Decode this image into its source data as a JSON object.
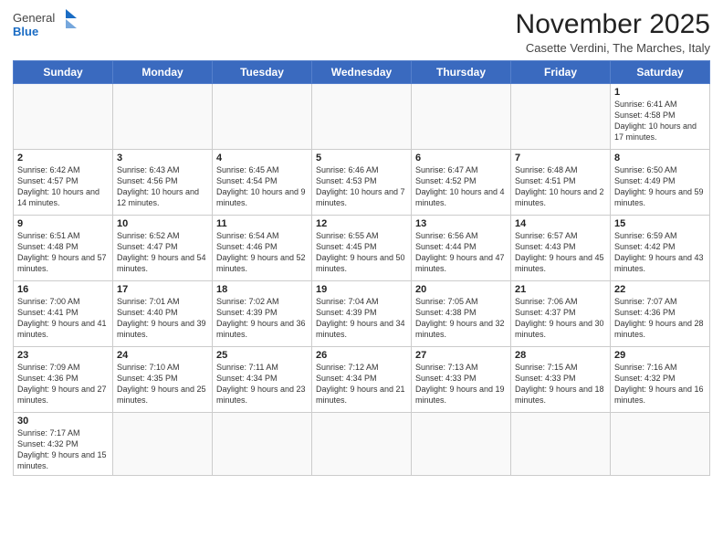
{
  "header": {
    "logo_general": "General",
    "logo_blue": "Blue",
    "month_title": "November 2025",
    "location": "Casette Verdini, The Marches, Italy"
  },
  "weekdays": [
    "Sunday",
    "Monday",
    "Tuesday",
    "Wednesday",
    "Thursday",
    "Friday",
    "Saturday"
  ],
  "weeks": [
    [
      {
        "day": "",
        "info": ""
      },
      {
        "day": "",
        "info": ""
      },
      {
        "day": "",
        "info": ""
      },
      {
        "day": "",
        "info": ""
      },
      {
        "day": "",
        "info": ""
      },
      {
        "day": "",
        "info": ""
      },
      {
        "day": "1",
        "info": "Sunrise: 6:41 AM\nSunset: 4:58 PM\nDaylight: 10 hours\nand 17 minutes."
      }
    ],
    [
      {
        "day": "2",
        "info": "Sunrise: 6:42 AM\nSunset: 4:57 PM\nDaylight: 10 hours\nand 14 minutes."
      },
      {
        "day": "3",
        "info": "Sunrise: 6:43 AM\nSunset: 4:56 PM\nDaylight: 10 hours\nand 12 minutes."
      },
      {
        "day": "4",
        "info": "Sunrise: 6:45 AM\nSunset: 4:54 PM\nDaylight: 10 hours\nand 9 minutes."
      },
      {
        "day": "5",
        "info": "Sunrise: 6:46 AM\nSunset: 4:53 PM\nDaylight: 10 hours\nand 7 minutes."
      },
      {
        "day": "6",
        "info": "Sunrise: 6:47 AM\nSunset: 4:52 PM\nDaylight: 10 hours\nand 4 minutes."
      },
      {
        "day": "7",
        "info": "Sunrise: 6:48 AM\nSunset: 4:51 PM\nDaylight: 10 hours\nand 2 minutes."
      },
      {
        "day": "8",
        "info": "Sunrise: 6:50 AM\nSunset: 4:49 PM\nDaylight: 9 hours\nand 59 minutes."
      }
    ],
    [
      {
        "day": "9",
        "info": "Sunrise: 6:51 AM\nSunset: 4:48 PM\nDaylight: 9 hours\nand 57 minutes."
      },
      {
        "day": "10",
        "info": "Sunrise: 6:52 AM\nSunset: 4:47 PM\nDaylight: 9 hours\nand 54 minutes."
      },
      {
        "day": "11",
        "info": "Sunrise: 6:54 AM\nSunset: 4:46 PM\nDaylight: 9 hours\nand 52 minutes."
      },
      {
        "day": "12",
        "info": "Sunrise: 6:55 AM\nSunset: 4:45 PM\nDaylight: 9 hours\nand 50 minutes."
      },
      {
        "day": "13",
        "info": "Sunrise: 6:56 AM\nSunset: 4:44 PM\nDaylight: 9 hours\nand 47 minutes."
      },
      {
        "day": "14",
        "info": "Sunrise: 6:57 AM\nSunset: 4:43 PM\nDaylight: 9 hours\nand 45 minutes."
      },
      {
        "day": "15",
        "info": "Sunrise: 6:59 AM\nSunset: 4:42 PM\nDaylight: 9 hours\nand 43 minutes."
      }
    ],
    [
      {
        "day": "16",
        "info": "Sunrise: 7:00 AM\nSunset: 4:41 PM\nDaylight: 9 hours\nand 41 minutes."
      },
      {
        "day": "17",
        "info": "Sunrise: 7:01 AM\nSunset: 4:40 PM\nDaylight: 9 hours\nand 39 minutes."
      },
      {
        "day": "18",
        "info": "Sunrise: 7:02 AM\nSunset: 4:39 PM\nDaylight: 9 hours\nand 36 minutes."
      },
      {
        "day": "19",
        "info": "Sunrise: 7:04 AM\nSunset: 4:39 PM\nDaylight: 9 hours\nand 34 minutes."
      },
      {
        "day": "20",
        "info": "Sunrise: 7:05 AM\nSunset: 4:38 PM\nDaylight: 9 hours\nand 32 minutes."
      },
      {
        "day": "21",
        "info": "Sunrise: 7:06 AM\nSunset: 4:37 PM\nDaylight: 9 hours\nand 30 minutes."
      },
      {
        "day": "22",
        "info": "Sunrise: 7:07 AM\nSunset: 4:36 PM\nDaylight: 9 hours\nand 28 minutes."
      }
    ],
    [
      {
        "day": "23",
        "info": "Sunrise: 7:09 AM\nSunset: 4:36 PM\nDaylight: 9 hours\nand 27 minutes."
      },
      {
        "day": "24",
        "info": "Sunrise: 7:10 AM\nSunset: 4:35 PM\nDaylight: 9 hours\nand 25 minutes."
      },
      {
        "day": "25",
        "info": "Sunrise: 7:11 AM\nSunset: 4:34 PM\nDaylight: 9 hours\nand 23 minutes."
      },
      {
        "day": "26",
        "info": "Sunrise: 7:12 AM\nSunset: 4:34 PM\nDaylight: 9 hours\nand 21 minutes."
      },
      {
        "day": "27",
        "info": "Sunrise: 7:13 AM\nSunset: 4:33 PM\nDaylight: 9 hours\nand 19 minutes."
      },
      {
        "day": "28",
        "info": "Sunrise: 7:15 AM\nSunset: 4:33 PM\nDaylight: 9 hours\nand 18 minutes."
      },
      {
        "day": "29",
        "info": "Sunrise: 7:16 AM\nSunset: 4:32 PM\nDaylight: 9 hours\nand 16 minutes."
      }
    ],
    [
      {
        "day": "30",
        "info": "Sunrise: 7:17 AM\nSunset: 4:32 PM\nDaylight: 9 hours\nand 15 minutes."
      },
      {
        "day": "",
        "info": ""
      },
      {
        "day": "",
        "info": ""
      },
      {
        "day": "",
        "info": ""
      },
      {
        "day": "",
        "info": ""
      },
      {
        "day": "",
        "info": ""
      },
      {
        "day": "",
        "info": ""
      }
    ]
  ]
}
